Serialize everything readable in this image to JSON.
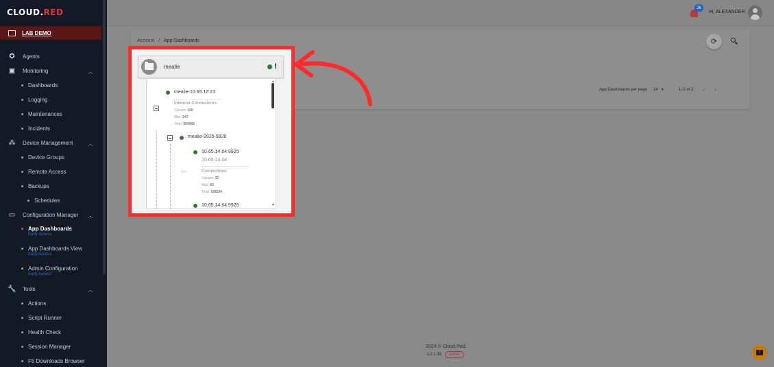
{
  "brand": {
    "logo_left": "CL",
    "logo_mid": "O",
    "logo_right": "UD.",
    "logo_red": "RED"
  },
  "lab": {
    "label": "LAB DEMO"
  },
  "sidebar": {
    "agents": "Agents",
    "monitoring": "Monitoring",
    "dashboards": "Dashboards",
    "logging": "Logging",
    "maintenances": "Maintenances",
    "incidents": "Incidents",
    "device_management": "Device Management",
    "device_groups": "Device Groups",
    "remote_access": "Remote Access",
    "backups": "Backups",
    "schedules": "Schedules",
    "configuration_manager": "Configuration Manager",
    "app_dashboards": "App Dashboards",
    "app_dashboards_early": "Early Access",
    "app_dashboards_view": "App Dashboards View",
    "app_dashboards_view_early": "Early Access",
    "admin_configuration": "Admin Configuration",
    "admin_configuration_early": "Early Access",
    "tools": "Tools",
    "actions": "Actions",
    "script_runner": "Script Runner",
    "health_check": "Health Check",
    "session_manager": "Session Manager",
    "f5_downloads": "F5 Downloads Browser"
  },
  "topbar": {
    "notification_count": "26",
    "greeting": "Hi, ALEXANDER"
  },
  "breadcrumb": {
    "root": "Account",
    "sep": "/",
    "current": "App Dashboards"
  },
  "pager": {
    "per_page_label": "App Dashboards per page",
    "per_page_value": "24",
    "range": "1–2 of 2"
  },
  "dashboard": {
    "folder_name": "mealie",
    "warning_glyph": "!",
    "tree": {
      "root_node": "mealie-10.65.12.23",
      "inbound_header": "Inbound Connections:",
      "inbound_current_label": "Current:",
      "inbound_current": "100",
      "inbound_max_label": "Max:",
      "inbound_max": "247",
      "inbound_total_label": "Total:",
      "inbound_total": "504905",
      "pool_node": "mealie-9925-9928",
      "member1": "10.65.14.64:9925",
      "member1_sub": "10.65.14.64",
      "conn_header": "Connections:",
      "conn_current_label": "Current:",
      "conn_current": "32",
      "conn_max_label": "Max:",
      "conn_max": "83",
      "conn_total_label": "Total:",
      "conn_total": "168294",
      "member2": "10.65.14.64:9926"
    }
  },
  "footer": {
    "copyright": "2024 © Cloud.Red",
    "version": "v.2.1.36",
    "role": "admin"
  },
  "colors": {
    "highlight": "#ff2a2a",
    "status_green": "#2e7d32",
    "sidebar_bg": "#131a26",
    "lab_bg": "#5a1616",
    "early_access": "#2f6fd0"
  }
}
